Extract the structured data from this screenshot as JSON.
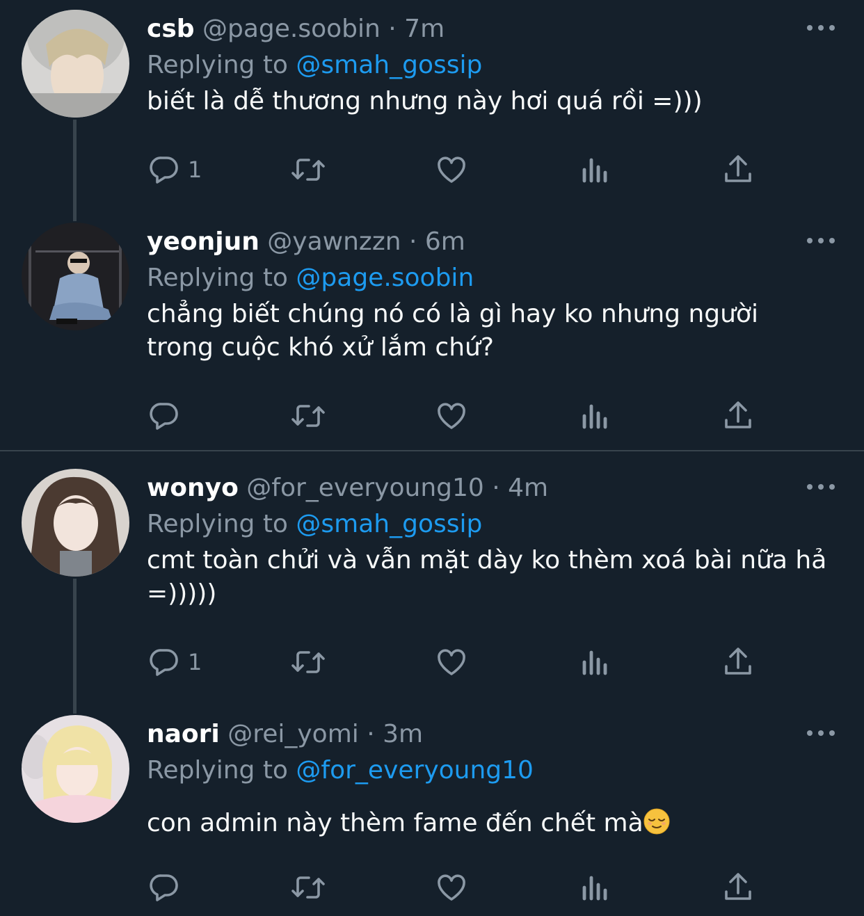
{
  "tweets": [
    {
      "display_name": "csb",
      "handle": "@page.soobin",
      "time": "· 7m",
      "replying_label": "Replying to",
      "replying_to": "@smah_gossip",
      "text": "biết là dễ thương nhưng này hơi quá rồi =)))",
      "reply_count": "1",
      "avatar_colors": [
        "#d8d8d6",
        "#c2b69a",
        "#e9dccd"
      ]
    },
    {
      "display_name": "yeonjun",
      "handle": "@yawnzzn",
      "time": "· 6m",
      "replying_label": "Replying to",
      "replying_to": "@page.soobin",
      "text_lines": [
        "chẳng biết chúng nó có là gì hay ko nhưng người",
        "trong cuộc khó xử lắm chứ?"
      ],
      "reply_count": "",
      "avatar_colors": [
        "#1e1e22",
        "#8aa3c4",
        "#3d3d42"
      ]
    },
    {
      "display_name": "wonyo",
      "handle": "@for_everyoung10",
      "time": "· 4m",
      "replying_label": "Replying to",
      "replying_to": "@smah_gossip",
      "text_lines": [
        "cmt toàn chửi và vẫn mặt dày ko thèm xoá bài nữa hả",
        "=)))))"
      ],
      "reply_count": "1",
      "avatar_colors": [
        "#d9d2cc",
        "#4a3a33",
        "#f1e3db"
      ]
    },
    {
      "display_name": "naori",
      "handle": "@rei_yomi",
      "time": "· 3m",
      "replying_label": "Replying to",
      "replying_to": "@for_everyoung10",
      "text": "con admin này thèm fame đến chết mà",
      "emoji": "relieved-face",
      "reply_count": "",
      "avatar_colors": [
        "#e8e1e6",
        "#f2e6a8",
        "#f7d9de"
      ]
    }
  ],
  "theme": {
    "background": "#15202b",
    "secondary_text": "#8b98a5",
    "link": "#1d9bf0",
    "divider": "#38444d",
    "icon": "#8b98a5"
  },
  "icons": [
    "reply-icon",
    "retweet-icon",
    "like-icon",
    "views-icon",
    "share-icon",
    "more-icon"
  ]
}
